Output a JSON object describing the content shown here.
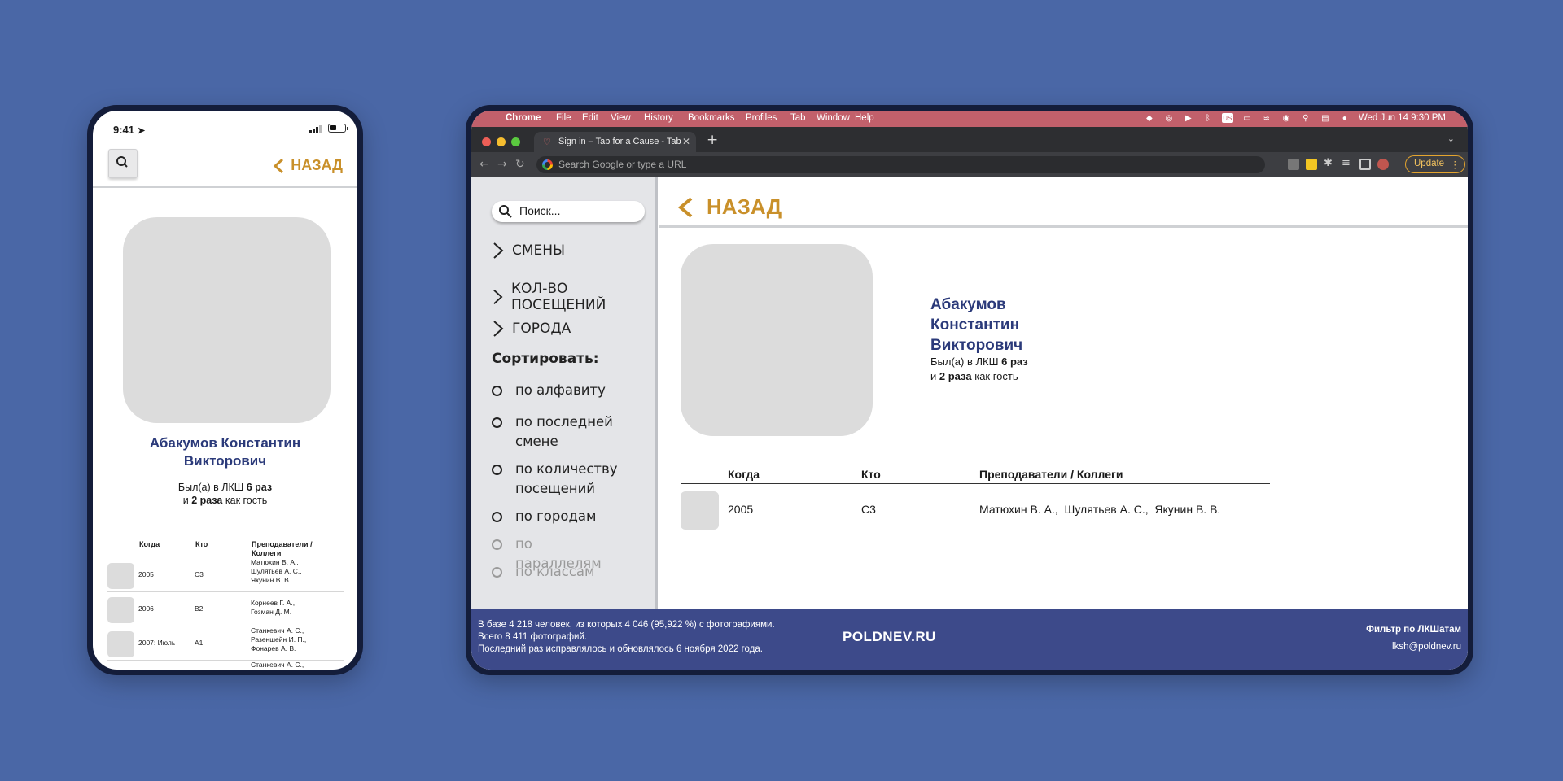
{
  "phone": {
    "status_time": "9:41",
    "back_label": "НАЗАД",
    "search_icon": "search-icon",
    "name": "Абакумов Константин Викторович",
    "visits_line1_prefix": "Был(а) в ЛКШ",
    "visits_count": "6 раз",
    "visits_line2_prefix": "и",
    "guest_count": "2 раза",
    "visits_line2_suffix": "как гость",
    "columns": [
      "Когда",
      "Кто",
      "Преподаватели / Коллеги"
    ],
    "rows": [
      {
        "when": "2005",
        "who": "С3",
        "colleagues": "Матюхин В. А., Шулятьев А. С., Якунин В. В."
      },
      {
        "when": "2006",
        "who": "В2",
        "colleagues": "Корнеев Г. А., Гозман Д. М."
      },
      {
        "when": "2007: Июль",
        "who": "А1",
        "colleagues": "Станкевич А. С., Разеншейн И. П., Фонарев А. В."
      },
      {
        "when": "",
        "who": "",
        "colleagues": "Станкевич А. С.,"
      }
    ]
  },
  "menubar": {
    "apple_icon": "apple-icon",
    "items": [
      "Chrome",
      "File",
      "Edit",
      "View",
      "History",
      "Bookmarks",
      "Profiles",
      "Tab",
      "Window",
      "Help"
    ],
    "datetime": "Wed Jun 14  9:30 PM"
  },
  "browser": {
    "tab_title": "Sign in – Tab for a Cause - Tab",
    "address_placeholder": "Search Google or type a URL",
    "update_label": "Update"
  },
  "sidebar": {
    "search_placeholder": "Поиск...",
    "categories": [
      "СМЕНЫ",
      "КОЛ-ВО ПОСЕЩЕНИЙ",
      "ГОРОДА"
    ],
    "sort_label": "Сортировать:",
    "sort_options": [
      "по алфавиту",
      "по последней смене",
      "по количеству посещений",
      "по городам",
      "по параллелям",
      "по классам"
    ]
  },
  "main": {
    "back_label": "НАЗАД",
    "name_lines": [
      "Абакумов",
      "Константин",
      "Викторович"
    ],
    "visits_line1_prefix": "Был(а) в ЛКШ",
    "visits_count": "6 раз",
    "visits_line2_prefix": "и",
    "guest_count": "2 раза",
    "visits_line2_suffix": "как гость",
    "columns": [
      "Когда",
      "Кто",
      "Преподаватели / Коллеги"
    ],
    "rows": [
      {
        "when": "2005",
        "who": "С3",
        "colleagues": "Матюхин В. А.,  Шулятьев А. С.,  Якунин В. В."
      }
    ]
  },
  "footer": {
    "info": [
      "В базе 4 218 человек, из которых 4 046 (95,922 %) с фотографиями.",
      "Всего 8 411 фотографий.",
      "Последний раз исправлялось и обновлялось 6 ноября 2022 года."
    ],
    "logo": "POLDNEV.RU",
    "filter_link": "Фильтр по ЛКШатам",
    "email": "lksh@poldnev.ru"
  },
  "colors": {
    "background": "#4a67a6",
    "accent": "#c9902a",
    "name": "#2b3a7a",
    "footer": "#3d4a8a",
    "menubar": "#c2606b"
  }
}
